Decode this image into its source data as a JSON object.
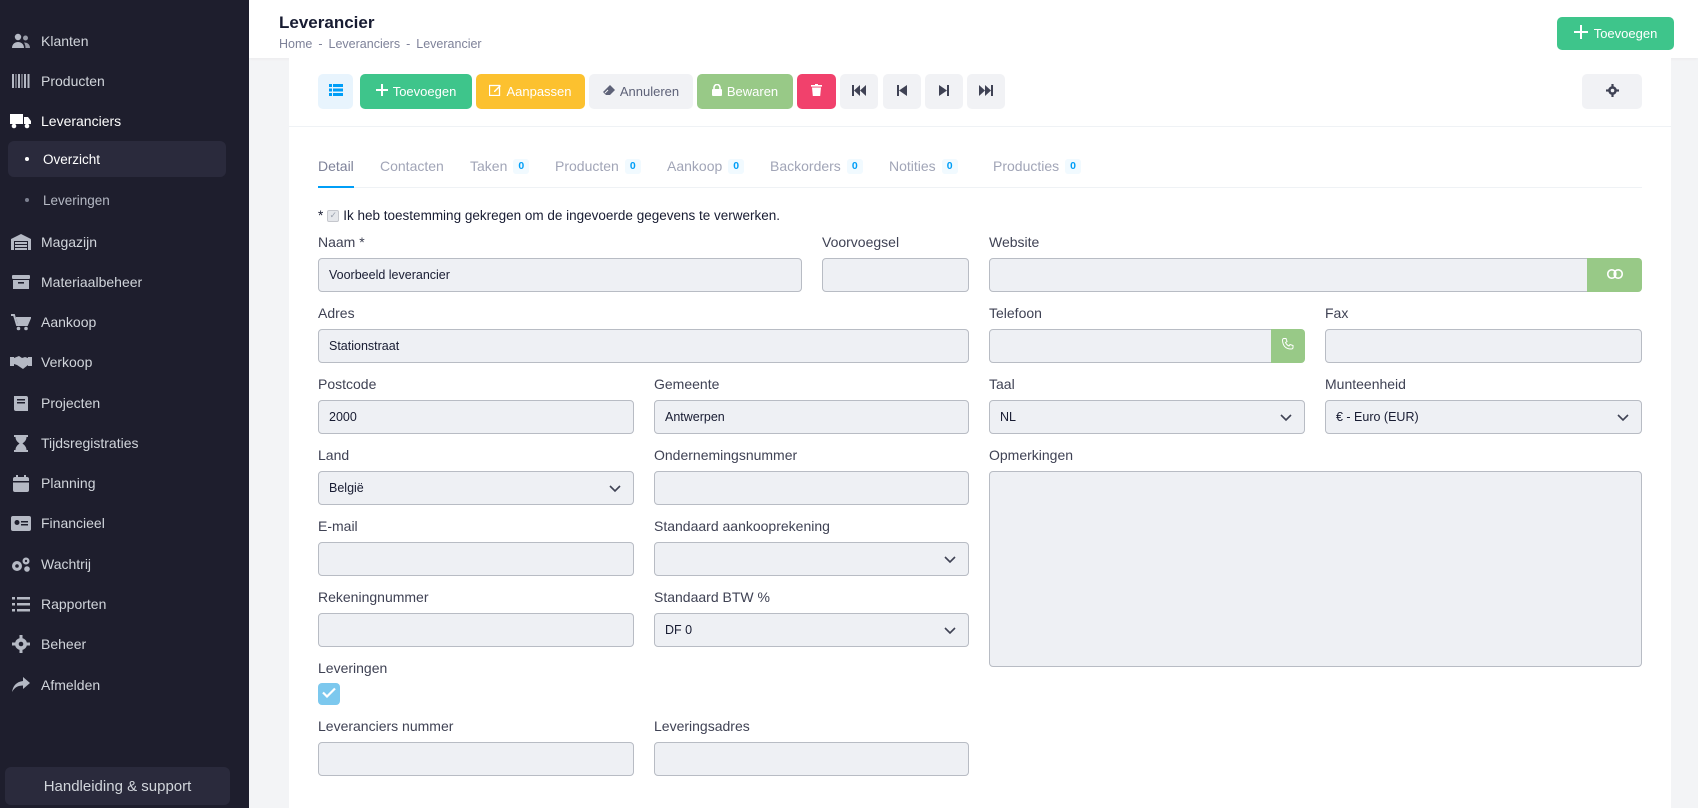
{
  "sidebar": {
    "items": [
      {
        "label": "Klanten",
        "icon": "users-icon"
      },
      {
        "label": "Producten",
        "icon": "barcode-icon"
      },
      {
        "label": "Leveranciers",
        "icon": "truck-icon"
      },
      {
        "label": "Magazijn",
        "icon": "warehouse-icon"
      },
      {
        "label": "Materiaalbeheer",
        "icon": "archive-icon"
      },
      {
        "label": "Aankoop",
        "icon": "cart-icon"
      },
      {
        "label": "Verkoop",
        "icon": "handshake-icon"
      },
      {
        "label": "Projecten",
        "icon": "book-icon"
      },
      {
        "label": "Tijdsregistraties",
        "icon": "hourglass-icon"
      },
      {
        "label": "Planning",
        "icon": "calendar-icon"
      },
      {
        "label": "Financieel",
        "icon": "money-card-icon"
      },
      {
        "label": "Wachtrij",
        "icon": "cogs-icon"
      },
      {
        "label": "Rapporten",
        "icon": "list-icon"
      },
      {
        "label": "Beheer",
        "icon": "gear-icon"
      },
      {
        "label": "Afmelden",
        "icon": "share-icon"
      }
    ],
    "subitems": [
      {
        "label": "Overzicht"
      },
      {
        "label": "Leveringen"
      }
    ],
    "support_label": "Handleiding & support"
  },
  "header": {
    "title": "Leverancier",
    "breadcrumb": [
      "Home",
      "Leveranciers",
      "Leverancier"
    ],
    "add_label": "Toevoegen"
  },
  "toolbar": {
    "add_label": "Toevoegen",
    "edit_label": "Aanpassen",
    "cancel_label": "Annuleren",
    "save_label": "Bewaren"
  },
  "colors": {
    "sidebar_bg": "#1e1e2d",
    "primary_green": "#3ec58b",
    "warning": "#fcc12f",
    "danger": "#f1416c",
    "save_green": "#98c987",
    "accent_blue": "#009ef7"
  },
  "tabs": [
    {
      "label": "Detail",
      "count": ""
    },
    {
      "label": "Contacten",
      "count": ""
    },
    {
      "label": "Taken",
      "count": "0"
    },
    {
      "label": "Producten",
      "count": "0"
    },
    {
      "label": "Aankoop",
      "count": "0"
    },
    {
      "label": "Backorders",
      "count": "0"
    },
    {
      "label": "Notities",
      "count": "0"
    },
    {
      "label": "Producties",
      "count": "0"
    }
  ],
  "form": {
    "consent_prefix": "*",
    "consent_text": "Ik heb toestemming gekregen om de ingevoerde gegevens te verwerken.",
    "naam": {
      "label": "Naam *",
      "value": "Voorbeeld leverancier"
    },
    "voorvoegsel": {
      "label": "Voorvoegsel",
      "value": ""
    },
    "website": {
      "label": "Website",
      "value": ""
    },
    "adres": {
      "label": "Adres",
      "value": "Stationstraat"
    },
    "telefoon": {
      "label": "Telefoon",
      "value": ""
    },
    "fax": {
      "label": "Fax",
      "value": ""
    },
    "postcode": {
      "label": "Postcode",
      "value": "2000"
    },
    "gemeente": {
      "label": "Gemeente",
      "value": "Antwerpen"
    },
    "taal": {
      "label": "Taal",
      "value": "NL"
    },
    "munteenheid": {
      "label": "Munteenheid",
      "value": "€ - Euro (EUR)"
    },
    "land": {
      "label": "Land",
      "value": "België"
    },
    "ondernemingsnummer": {
      "label": "Ondernemingsnummer",
      "value": ""
    },
    "opmerkingen": {
      "label": "Opmerkingen",
      "value": ""
    },
    "email": {
      "label": "E-mail",
      "value": ""
    },
    "aankooprekening": {
      "label": "Standaard aankooprekening",
      "value": ""
    },
    "rekeningnummer": {
      "label": "Rekeningnummer",
      "value": ""
    },
    "btw": {
      "label": "Standaard BTW %",
      "value": "DF 0"
    },
    "leveringen": {
      "label": "Leveringen",
      "checked": true
    },
    "leveranciers_nummer": {
      "label": "Leveranciers nummer",
      "value": ""
    },
    "leveringsadres": {
      "label": "Leveringsadres",
      "value": ""
    }
  }
}
